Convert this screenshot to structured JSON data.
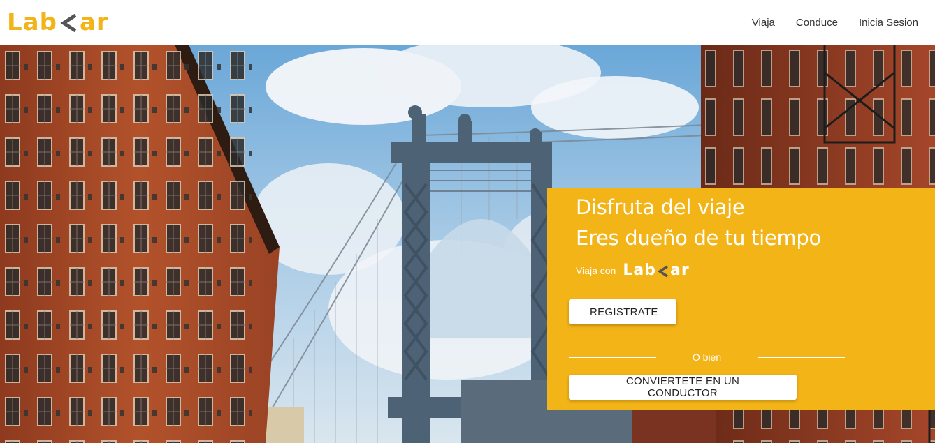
{
  "brand": {
    "logo_left": "Lab",
    "logo_right": "ar"
  },
  "nav": {
    "items": [
      {
        "label": "Viaja"
      },
      {
        "label": "Conduce"
      },
      {
        "label": "Inicia Sesion"
      }
    ]
  },
  "hero": {
    "headline_1": "Disfruta del viaje",
    "headline_2": "Eres dueño de tu tiempo",
    "viaja_con": "Viaja con",
    "mini_logo_left": "Lab",
    "mini_logo_right": "ar",
    "register_button": "REGISTRATE",
    "divider_text": "O bien",
    "driver_button": "CONVIERTETE EN UN CONDUCTOR"
  },
  "colors": {
    "brand_yellow": "#f3b418",
    "logo_chevron": "#555555"
  }
}
